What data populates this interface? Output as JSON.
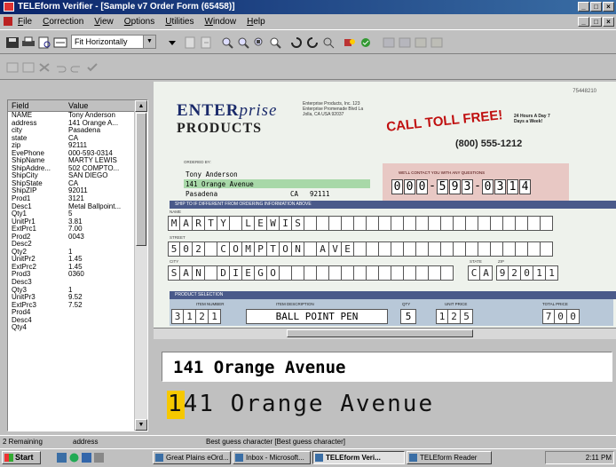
{
  "window": {
    "title": "TELEform Verifier - [Sample v7 Order Form (65458)]"
  },
  "menu": [
    "File",
    "Correction",
    "View",
    "Options",
    "Utilities",
    "Window",
    "Help"
  ],
  "toolbar": {
    "fit_select": "Fit Horizontally"
  },
  "field_panel": {
    "headers": {
      "field": "Field",
      "value": "Value"
    },
    "rows": [
      {
        "field": "NAME",
        "value": "Tony Anderson"
      },
      {
        "field": "address",
        "value": "141 Orange A..."
      },
      {
        "field": "city",
        "value": "Pasadena"
      },
      {
        "field": "state",
        "value": "CA"
      },
      {
        "field": "zip",
        "value": "92111"
      },
      {
        "field": "EvePhone",
        "value": "000-593-0314"
      },
      {
        "field": "ShipName",
        "value": "MARTY LEWIS"
      },
      {
        "field": "ShipAddre...",
        "value": "502 COMPTO..."
      },
      {
        "field": "ShipCity",
        "value": "SAN DIEGO"
      },
      {
        "field": "ShipState",
        "value": "CA"
      },
      {
        "field": "ShipZIP",
        "value": "92011"
      },
      {
        "field": "Prod1",
        "value": "3121"
      },
      {
        "field": "Desc1",
        "value": "Metal Ballpoint..."
      },
      {
        "field": "Qty1",
        "value": "5"
      },
      {
        "field": "UnitPr1",
        "value": "3.81"
      },
      {
        "field": "ExtPrc1",
        "value": "7.00"
      },
      {
        "field": "Prod2",
        "value": "0043"
      },
      {
        "field": "Desc2",
        "value": ""
      },
      {
        "field": "Qty2",
        "value": "1"
      },
      {
        "field": "UnitPr2",
        "value": "1.45"
      },
      {
        "field": "ExtPrc2",
        "value": "1.45"
      },
      {
        "field": "Prod3",
        "value": "0360"
      },
      {
        "field": "Desc3",
        "value": ""
      },
      {
        "field": "Qty3",
        "value": "1"
      },
      {
        "field": "UnitPr3",
        "value": "9.52"
      },
      {
        "field": "ExtPrc3",
        "value": "7.52"
      },
      {
        "field": "Prod4",
        "value": ""
      },
      {
        "field": "Desc4",
        "value": ""
      },
      {
        "field": "Qty4",
        "value": ""
      }
    ]
  },
  "form": {
    "order_number": "75448210",
    "logo_line1": "ENTER",
    "logo_line1_italic": "prise",
    "logo_line2": "PRODUCTS",
    "company_address": "Enterprise Products, Inc. 123 Enterprise Promenade Blvd La Jolla, CA USA 92037",
    "toll_free": "CALL TOLL FREE!",
    "toll_hours": "24 Hours A Day 7 Days a Week!",
    "toll_number": "(800) 555-1212",
    "contact_label": "WE'LL CONTACT YOU WITH ANY QUESTIONS",
    "phone": [
      "0",
      "0",
      "0",
      "5",
      "9",
      "3",
      "0",
      "3",
      "1",
      "4"
    ],
    "sold_to_label": "ORDERED BY:",
    "sold_to": {
      "name": "Tony Anderson",
      "address": "141 Orange Avenue",
      "city": "Pasadena",
      "state": "CA",
      "zip": "92111"
    },
    "ship_header": "SHIP TO IF DIFFERENT FROM ORDERING INFORMATION ABOVE",
    "name_label": "NAME",
    "street_label": "STREET",
    "city_label": "CITY",
    "state_label": "STATE",
    "zip_label": "ZIP",
    "ship_name": [
      "M",
      "A",
      "R",
      "T",
      "Y",
      "",
      "L",
      "E",
      "W",
      "I",
      "S",
      "",
      "",
      "",
      "",
      "",
      "",
      "",
      "",
      "",
      "",
      "",
      "",
      "",
      "",
      "",
      "",
      "",
      "",
      "",
      ""
    ],
    "ship_street": [
      "5",
      "0",
      "2",
      "",
      "C",
      "O",
      "M",
      "P",
      "T",
      "O",
      "N",
      "",
      "A",
      "V",
      "E",
      "",
      "",
      "",
      "",
      "",
      "",
      "",
      "",
      "",
      "",
      "",
      "",
      "",
      "",
      "",
      ""
    ],
    "ship_city": [
      "S",
      "A",
      "N",
      "",
      "D",
      "I",
      "E",
      "G",
      "O",
      "",
      "",
      "",
      "",
      "",
      "",
      "",
      "",
      "",
      "",
      "",
      "",
      "",
      ""
    ],
    "ship_state": [
      "C",
      "A"
    ],
    "ship_zip": [
      "9",
      "2",
      "0",
      "1",
      "1"
    ],
    "prod_header": "PRODUCT SELECTION",
    "prod_labels": {
      "item": "ITEM NUMBER",
      "desc": "ITEM DESCRIPTION",
      "qty": "QTY",
      "unit": "UNIT PRICE",
      "total": "TOTAL PRICE"
    },
    "prod1": {
      "item": [
        "3",
        "1",
        "2",
        "1"
      ],
      "desc": "BALL POINT PEN",
      "qty": "5",
      "unit": [
        "1",
        "2",
        "5"
      ],
      "total": [
        "7",
        "0",
        "0"
      ]
    }
  },
  "zoom": {
    "typed": "141 Orange Avenue",
    "image_text_first": "1",
    "image_text_rest": "41 Orange Avenue"
  },
  "status": {
    "remaining": "2 Remaining",
    "field": "address",
    "hint": "Best guess character [Best guess character]"
  },
  "taskbar": {
    "start": "Start",
    "tasks": [
      "Great Plains eOrd...",
      "Inbox - Microsoft...",
      "TELEform Veri...",
      "TELEform Reader"
    ],
    "clock": "2:11 PM"
  }
}
